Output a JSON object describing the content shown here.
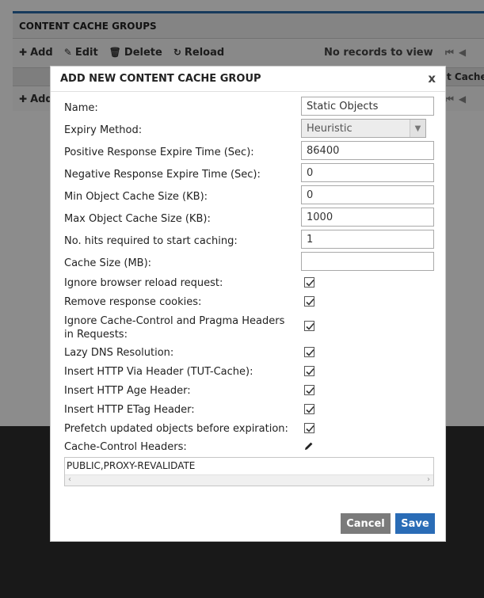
{
  "background": {
    "panel_title": "CONTENT CACHE GROUPS",
    "toolbar": {
      "add": "Add",
      "edit": "Edit",
      "delete": "Delete",
      "reload": "Reload"
    },
    "records_text": "No records to view",
    "grid_column_partial": "t Cache S"
  },
  "dialog": {
    "title": "ADD NEW CONTENT CACHE GROUP",
    "close_label": "x",
    "fields": {
      "name": {
        "label": "Name:",
        "value": "Static Objects"
      },
      "expiry": {
        "label": "Expiry Method:",
        "value": "Heuristic"
      },
      "positive": {
        "label": "Positive Response Expire Time (Sec):",
        "value": "86400"
      },
      "negative": {
        "label": "Negative Response Expire Time (Sec):",
        "value": "0"
      },
      "min_obj": {
        "label": "Min Object Cache Size (KB):",
        "value": "0"
      },
      "max_obj": {
        "label": "Max Object Cache Size (KB):",
        "value": "1000"
      },
      "hits": {
        "label": "No. hits required to start caching:",
        "value": "1"
      },
      "cache_size": {
        "label": "Cache Size (MB):",
        "value": ""
      }
    },
    "checkboxes": {
      "ignore_reload": {
        "label": "Ignore browser reload request:",
        "checked": true
      },
      "remove_cookies": {
        "label": "Remove response cookies:",
        "checked": true
      },
      "ignore_cc": {
        "label": "Ignore Cache-Control and Pragma Headers in Requests:",
        "checked": true
      },
      "lazy_dns": {
        "label": "Lazy DNS Resolution:",
        "checked": true
      },
      "via_header": {
        "label": "Insert HTTP Via Header (TUT-Cache):",
        "checked": true
      },
      "age_header": {
        "label": "Insert HTTP Age Header:",
        "checked": true
      },
      "etag_header": {
        "label": "Insert HTTP ETag Header:",
        "checked": true
      },
      "prefetch": {
        "label": "Prefetch updated objects before expiration:",
        "checked": true
      }
    },
    "cache_control": {
      "label": "Cache-Control Headers:",
      "value": "PUBLIC,PROXY-REVALIDATE"
    },
    "buttons": {
      "cancel": "Cancel",
      "save": "Save"
    }
  },
  "colors": {
    "accent_blue": "#2a6cb6",
    "cancel_gray": "#7b7b7b",
    "overlay": "#000000"
  }
}
